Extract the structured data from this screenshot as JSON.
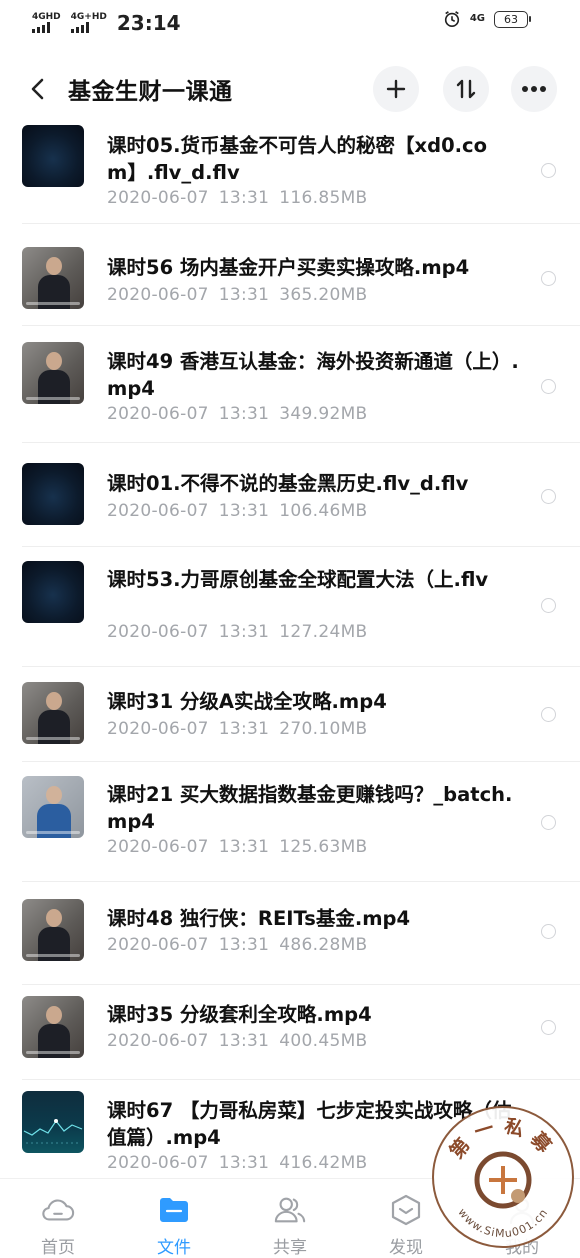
{
  "status_bar": {
    "signal_1": "4GHD",
    "signal_2": "4G+HD",
    "time": "23:14",
    "network": "4G",
    "battery": "63"
  },
  "header": {
    "title": "基金生财一课通",
    "back_icon": "chevron-left-icon",
    "add_icon": "plus-icon",
    "sort_icon": "sort-icon",
    "more_icon": "more-icon"
  },
  "files": [
    {
      "name": "课时05.货币基金不可告人的秘密【xd0.com】.flv_d.flv",
      "date": "2020-06-07",
      "time": "13:31",
      "size": "116.85MB",
      "thumb": "dark-video"
    },
    {
      "name": "课时56 场内基金开户买卖实操攻略.mp4",
      "date": "2020-06-07",
      "time": "13:31",
      "size": "365.20MB",
      "thumb": "presenter"
    },
    {
      "name": "课时49 香港互认基金：海外投资新通道（上）.mp4",
      "date": "2020-06-07",
      "time": "13:31",
      "size": "349.92MB",
      "thumb": "presenter"
    },
    {
      "name": "课时01.不得不说的基金黑历史.flv_d.flv",
      "date": "2020-06-07",
      "time": "13:31",
      "size": "106.46MB",
      "thumb": "dark-video"
    },
    {
      "name": "课时53.力哥原创基金全球配置大法（上.flv",
      "date": "2020-06-07",
      "time": "13:31",
      "size": "127.24MB",
      "thumb": "dark-video"
    },
    {
      "name": "课时31 分级A实战全攻略.mp4",
      "date": "2020-06-07",
      "time": "13:31",
      "size": "270.10MB",
      "thumb": "presenter"
    },
    {
      "name": "课时21 买大数据指数基金更赚钱吗？_batch.mp4",
      "date": "2020-06-07",
      "time": "13:31",
      "size": "125.63MB",
      "thumb": "presenter-light"
    },
    {
      "name": "课时48 独行侠：REITs基金.mp4",
      "date": "2020-06-07",
      "time": "13:31",
      "size": "486.28MB",
      "thumb": "presenter"
    },
    {
      "name": "课时35 分级套利全攻略.mp4",
      "date": "2020-06-07",
      "time": "13:31",
      "size": "400.45MB",
      "thumb": "presenter"
    },
    {
      "name": "课时67 【力哥私房菜】七步定投实战攻略（估值篇）.mp4",
      "date": "2020-06-07",
      "time": "13:31",
      "size": "416.42MB",
      "thumb": "chart"
    }
  ],
  "tabs": [
    {
      "label": "首页",
      "icon": "cloud-icon",
      "active": false
    },
    {
      "label": "文件",
      "icon": "folder-icon",
      "active": true
    },
    {
      "label": "共享",
      "icon": "people-icon",
      "active": false
    },
    {
      "label": "发现",
      "icon": "cube-icon",
      "active": false
    },
    {
      "label": "我的",
      "icon": "user-icon",
      "active": false
    }
  ],
  "watermark": {
    "text_top": "第一私募",
    "text_url": "www.SiMu001.cn"
  },
  "colors": {
    "accent": "#2f9bff",
    "meta_text": "#a3a6ab",
    "title_text": "#111111"
  }
}
